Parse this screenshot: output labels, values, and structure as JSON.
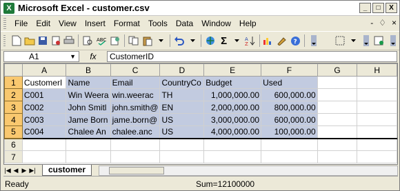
{
  "window": {
    "title": "Microsoft Excel - customer.csv",
    "app_icon": "excel-icon"
  },
  "title_buttons": {
    "minimize": "_",
    "maximize": "□",
    "close": "X"
  },
  "menu": {
    "items": [
      "File",
      "Edit",
      "View",
      "Insert",
      "Format",
      "Tools",
      "Data",
      "Window",
      "Help"
    ],
    "right": {
      "minimize": "-",
      "restore": "♢",
      "close": "×"
    }
  },
  "formula_bar": {
    "name_box": "A1",
    "fx_label": "fx",
    "formula": "CustomerID"
  },
  "sheet": {
    "columns": [
      "A",
      "B",
      "C",
      "D",
      "E",
      "F",
      "G",
      "H"
    ],
    "rows": [
      {
        "num": "1",
        "cells": [
          "CustomerI",
          "Name",
          "Email",
          "CountryCo",
          "Budget",
          "Used",
          "",
          ""
        ]
      },
      {
        "num": "2",
        "cells": [
          "C001",
          "Win Weera",
          "win.weerac",
          "TH",
          "1,000,000.00",
          "600,000.00",
          "",
          ""
        ]
      },
      {
        "num": "3",
        "cells": [
          "C002",
          "John Smitl",
          "john.smith@",
          "EN",
          "2,000,000.00",
          "800,000.00",
          "",
          ""
        ]
      },
      {
        "num": "4",
        "cells": [
          "C003",
          "Jame Born",
          "jame.born@",
          "US",
          "3,000,000.00",
          "600,000.00",
          "",
          ""
        ]
      },
      {
        "num": "5",
        "cells": [
          "C004",
          "Chalee An",
          "chalee.anc",
          "US",
          "4,000,000.00",
          "100,000.00",
          "",
          ""
        ]
      },
      {
        "num": "6",
        "cells": [
          "",
          "",
          "",
          "",
          "",
          "",
          "",
          ""
        ]
      },
      {
        "num": "7",
        "cells": [
          "",
          "",
          "",
          "",
          "",
          "",
          "",
          ""
        ]
      }
    ]
  },
  "sheet_tabs": {
    "active": "customer"
  },
  "status": {
    "ready": "Ready",
    "sum": "Sum=12100000"
  },
  "colors": {
    "selection": "#c2cbe0",
    "header_highlight": "#f9c86f"
  }
}
